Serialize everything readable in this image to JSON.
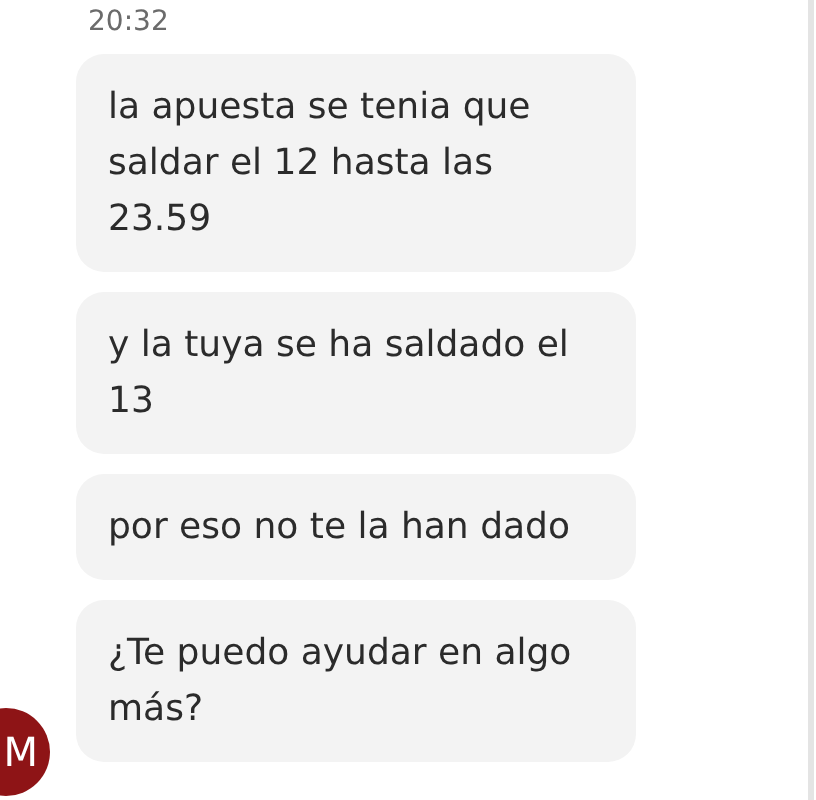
{
  "timestamp": "20:32",
  "messages": [
    {
      "text": "la apuesta se tenia que saldar el 12 hasta las 23.59"
    },
    {
      "text": "y la tuya se ha saldado el 13"
    },
    {
      "text": "por eso no te la han dado"
    },
    {
      "text": "¿Te puedo ayudar en algo más?"
    }
  ],
  "avatar": {
    "initial": "M"
  }
}
